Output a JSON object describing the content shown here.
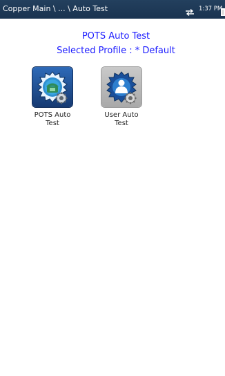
{
  "topbar": {
    "breadcrumb": "Copper Main \\ ... \\ Auto Test",
    "time": "1:37 PM",
    "icons": [
      "transfer-icon",
      "battery-icon"
    ]
  },
  "header": {
    "title": "POTS Auto Test",
    "profile": "Selected Profile : * Default"
  },
  "tiles": [
    {
      "label_line1": "POTS Auto",
      "label_line2": "Test",
      "icon": "phone-gear-badge-icon",
      "selected": true
    },
    {
      "label_line1": "User Auto",
      "label_line2": "Test",
      "icon": "user-gear-badge-icon",
      "selected": false
    }
  ],
  "colors": {
    "topbar": "#1f3a58",
    "header_text": "#1a1aff",
    "selected_tile": "#1e4f96",
    "unselected_tile": "#b8b8b8"
  }
}
